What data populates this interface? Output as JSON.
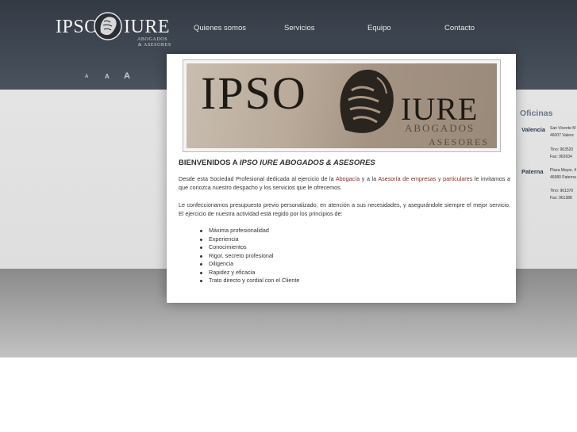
{
  "header": {
    "logo": {
      "left": "IPSO",
      "right": "IURE",
      "sub1": "ABOGADOS",
      "sub2": "& ASESORES"
    },
    "nav": [
      {
        "label": "Quienes somos"
      },
      {
        "label": "Servicios"
      },
      {
        "label": "Equipo"
      },
      {
        "label": "Contacto"
      }
    ],
    "font_sizes": [
      "A",
      "A",
      "A"
    ]
  },
  "banner": {
    "ipso": "IPSO",
    "iure": "IURE",
    "sub1": "ABOGADOS",
    "sub2": "ASESORES"
  },
  "main": {
    "welcome_prefix": "BIENVENIDOS A ",
    "welcome_name": "IPSO IURE ABOGADOS & ASESORES",
    "p1_a": "Desde esta Sociedad Profesional dedicada al ejercicio de la ",
    "p1_link1": "Abogacía",
    "p1_b": " y a la ",
    "p1_link2": "Asesoría de empresas y particulares",
    "p1_c": " le invitamos a que conozca nuestro despacho y los servicios que le ofrecemos.",
    "p2": "Le confeccionamos presupuesto previo personalizado, en atención a sus necesidades, y asegurándole siempre el mejor servicio. El ejercicio de nuestra actividad está regido por los principios de:",
    "principles": [
      "Máxima profesionalidad",
      "Experiencia",
      "Conocimientos",
      "Rigor, secreto profesional",
      "Diligencia",
      "Rapidez y eficacia",
      "Trato directo y cordial con el Cliente"
    ]
  },
  "offices": {
    "title": "Oficinas",
    "valencia": {
      "city": "Valencia",
      "addr1": "San Vicente M",
      "addr2": "46007 Valenc",
      "tel": "Tlno: 963520",
      "fax": "Fax: 963934"
    },
    "paterna": {
      "city": "Paterna",
      "addr1": "Plaza Mayor, 4",
      "addr2": "46980 Paterna",
      "tel": "Tlno: 961370",
      "fax": "Fax: 961388"
    }
  },
  "colors": {
    "header_bg": "#3d4550",
    "link": "#8a2a2a",
    "office_title": "#6a7580"
  }
}
